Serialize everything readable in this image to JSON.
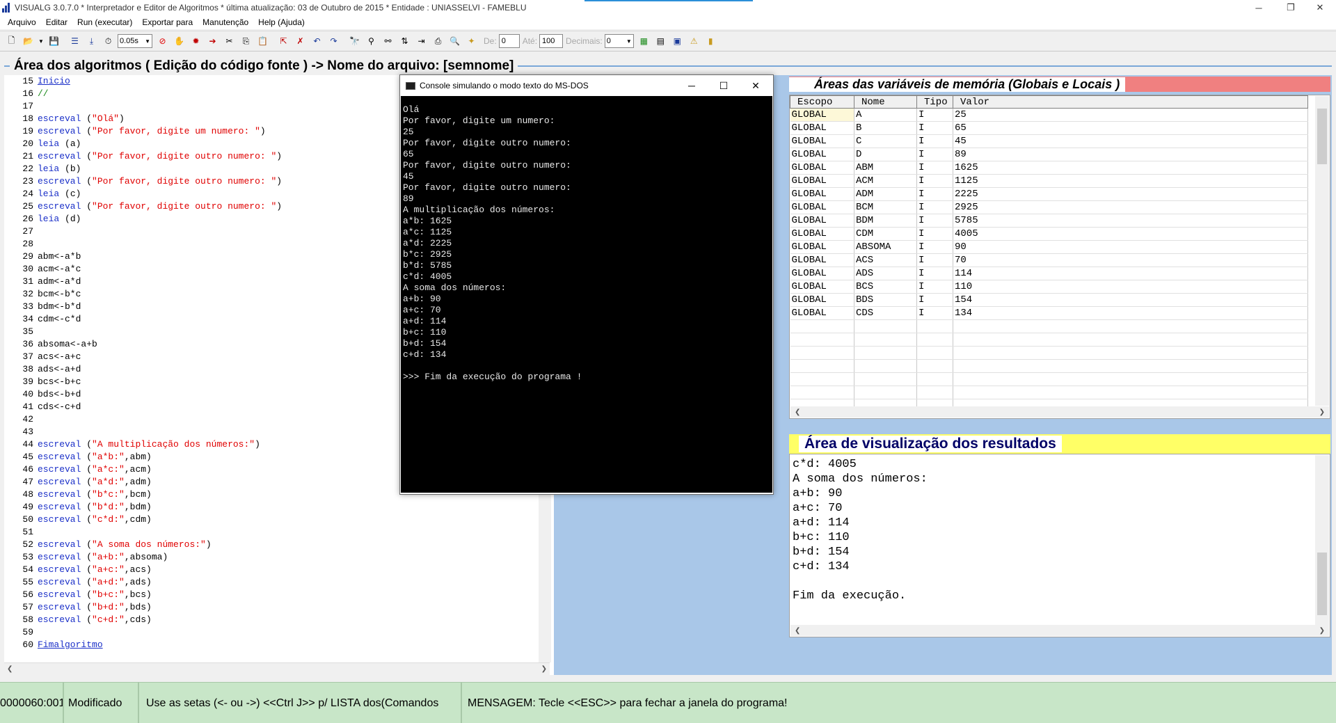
{
  "window": {
    "title": "VISUALG 3.0.7.0 * Interpretador e Editor de Algoritmos * última atualização: 03 de Outubro de 2015 * Entidade : UNIASSELVI - FAMEBLU",
    "controls": {
      "minimize": "─",
      "restore": "❐",
      "close": "✕"
    }
  },
  "menu": [
    "Arquivo",
    "Editar",
    "Run (executar)",
    "Exportar para",
    "Manutenção",
    "Help (Ajuda)"
  ],
  "toolbar": {
    "speed": "0.05s",
    "de_label": "De:",
    "de_value": "0",
    "ate_label": "Até:",
    "ate_value": "100",
    "decimais_label": "Decimais:",
    "decimais_value": "0"
  },
  "code_area": {
    "title": "Área dos algoritmos ( Edição do código fonte ) -> Nome do arquivo: [semnome]",
    "lines": [
      {
        "n": "15",
        "parts": [
          {
            "t": "Inicio",
            "c": "link"
          }
        ]
      },
      {
        "n": "16",
        "parts": [
          {
            "t": "//",
            "c": "com"
          }
        ]
      },
      {
        "n": "17",
        "parts": []
      },
      {
        "n": "18",
        "parts": [
          {
            "t": "escreval",
            "c": "kw"
          },
          {
            "t": " (",
            "c": ""
          },
          {
            "t": "\"Olá\"",
            "c": "str"
          },
          {
            "t": ")",
            "c": ""
          }
        ]
      },
      {
        "n": "19",
        "parts": [
          {
            "t": "escreval",
            "c": "kw"
          },
          {
            "t": " (",
            "c": ""
          },
          {
            "t": "\"Por favor, digite um numero: \"",
            "c": "str"
          },
          {
            "t": ")",
            "c": ""
          }
        ]
      },
      {
        "n": "20",
        "parts": [
          {
            "t": "leia",
            "c": "kw"
          },
          {
            "t": " (a)",
            "c": ""
          }
        ]
      },
      {
        "n": "21",
        "parts": [
          {
            "t": "escreval",
            "c": "kw"
          },
          {
            "t": " (",
            "c": ""
          },
          {
            "t": "\"Por favor, digite outro numero: \"",
            "c": "str"
          },
          {
            "t": ")",
            "c": ""
          }
        ]
      },
      {
        "n": "22",
        "parts": [
          {
            "t": "leia",
            "c": "kw"
          },
          {
            "t": " (b)",
            "c": ""
          }
        ]
      },
      {
        "n": "23",
        "parts": [
          {
            "t": "escreval",
            "c": "kw"
          },
          {
            "t": " (",
            "c": ""
          },
          {
            "t": "\"Por favor, digite outro numero: \"",
            "c": "str"
          },
          {
            "t": ")",
            "c": ""
          }
        ]
      },
      {
        "n": "24",
        "parts": [
          {
            "t": "leia",
            "c": "kw"
          },
          {
            "t": " (c)",
            "c": ""
          }
        ]
      },
      {
        "n": "25",
        "parts": [
          {
            "t": "escreval",
            "c": "kw"
          },
          {
            "t": " (",
            "c": ""
          },
          {
            "t": "\"Por favor, digite outro numero: \"",
            "c": "str"
          },
          {
            "t": ")",
            "c": ""
          }
        ]
      },
      {
        "n": "26",
        "parts": [
          {
            "t": "leia",
            "c": "kw"
          },
          {
            "t": " (d)",
            "c": ""
          }
        ]
      },
      {
        "n": "27",
        "parts": []
      },
      {
        "n": "28",
        "parts": []
      },
      {
        "n": "29",
        "parts": [
          {
            "t": "abm<-a*b",
            "c": ""
          }
        ]
      },
      {
        "n": "30",
        "parts": [
          {
            "t": "acm<-a*c",
            "c": ""
          }
        ]
      },
      {
        "n": "31",
        "parts": [
          {
            "t": "adm<-a*d",
            "c": ""
          }
        ]
      },
      {
        "n": "32",
        "parts": [
          {
            "t": "bcm<-b*c",
            "c": ""
          }
        ]
      },
      {
        "n": "33",
        "parts": [
          {
            "t": "bdm<-b*d",
            "c": ""
          }
        ]
      },
      {
        "n": "34",
        "parts": [
          {
            "t": "cdm<-c*d",
            "c": ""
          }
        ]
      },
      {
        "n": "35",
        "parts": []
      },
      {
        "n": "36",
        "parts": [
          {
            "t": "absoma<-a+b",
            "c": ""
          }
        ]
      },
      {
        "n": "37",
        "parts": [
          {
            "t": "acs<-a+c",
            "c": ""
          }
        ]
      },
      {
        "n": "38",
        "parts": [
          {
            "t": "ads<-a+d",
            "c": ""
          }
        ]
      },
      {
        "n": "39",
        "parts": [
          {
            "t": "bcs<-b+c",
            "c": ""
          }
        ]
      },
      {
        "n": "40",
        "parts": [
          {
            "t": "bds<-b+d",
            "c": ""
          }
        ]
      },
      {
        "n": "41",
        "parts": [
          {
            "t": "cds<-c+d",
            "c": ""
          }
        ]
      },
      {
        "n": "42",
        "parts": []
      },
      {
        "n": "43",
        "parts": []
      },
      {
        "n": "44",
        "parts": [
          {
            "t": "escreval",
            "c": "kw"
          },
          {
            "t": " (",
            "c": ""
          },
          {
            "t": "\"A multiplicação dos números:\"",
            "c": "str"
          },
          {
            "t": ")",
            "c": ""
          }
        ]
      },
      {
        "n": "45",
        "parts": [
          {
            "t": "escreval",
            "c": "kw"
          },
          {
            "t": " (",
            "c": ""
          },
          {
            "t": "\"a*b:\"",
            "c": "str"
          },
          {
            "t": ",abm)",
            "c": ""
          }
        ]
      },
      {
        "n": "46",
        "parts": [
          {
            "t": "escreval",
            "c": "kw"
          },
          {
            "t": " (",
            "c": ""
          },
          {
            "t": "\"a*c:\"",
            "c": "str"
          },
          {
            "t": ",acm)",
            "c": ""
          }
        ]
      },
      {
        "n": "47",
        "parts": [
          {
            "t": "escreval",
            "c": "kw"
          },
          {
            "t": " (",
            "c": ""
          },
          {
            "t": "\"a*d:\"",
            "c": "str"
          },
          {
            "t": ",adm)",
            "c": ""
          }
        ]
      },
      {
        "n": "48",
        "parts": [
          {
            "t": "escreval",
            "c": "kw"
          },
          {
            "t": " (",
            "c": ""
          },
          {
            "t": "\"b*c:\"",
            "c": "str"
          },
          {
            "t": ",bcm)",
            "c": ""
          }
        ]
      },
      {
        "n": "49",
        "parts": [
          {
            "t": "escreval",
            "c": "kw"
          },
          {
            "t": " (",
            "c": ""
          },
          {
            "t": "\"b*d:\"",
            "c": "str"
          },
          {
            "t": ",bdm)",
            "c": ""
          }
        ]
      },
      {
        "n": "50",
        "parts": [
          {
            "t": "escreval",
            "c": "kw"
          },
          {
            "t": " (",
            "c": ""
          },
          {
            "t": "\"c*d:\"",
            "c": "str"
          },
          {
            "t": ",cdm)",
            "c": ""
          }
        ]
      },
      {
        "n": "51",
        "parts": []
      },
      {
        "n": "52",
        "parts": [
          {
            "t": "escreval",
            "c": "kw"
          },
          {
            "t": " (",
            "c": ""
          },
          {
            "t": "\"A soma dos números:\"",
            "c": "str"
          },
          {
            "t": ")",
            "c": ""
          }
        ]
      },
      {
        "n": "53",
        "parts": [
          {
            "t": "escreval",
            "c": "kw"
          },
          {
            "t": " (",
            "c": ""
          },
          {
            "t": "\"a+b:\"",
            "c": "str"
          },
          {
            "t": ",absoma)",
            "c": ""
          }
        ]
      },
      {
        "n": "54",
        "parts": [
          {
            "t": "escreval",
            "c": "kw"
          },
          {
            "t": " (",
            "c": ""
          },
          {
            "t": "\"a+c:\"",
            "c": "str"
          },
          {
            "t": ",acs)",
            "c": ""
          }
        ]
      },
      {
        "n": "55",
        "parts": [
          {
            "t": "escreval",
            "c": "kw"
          },
          {
            "t": " (",
            "c": ""
          },
          {
            "t": "\"a+d:\"",
            "c": "str"
          },
          {
            "t": ",ads)",
            "c": ""
          }
        ]
      },
      {
        "n": "56",
        "parts": [
          {
            "t": "escreval",
            "c": "kw"
          },
          {
            "t": " (",
            "c": ""
          },
          {
            "t": "\"b+c:\"",
            "c": "str"
          },
          {
            "t": ",bcs)",
            "c": ""
          }
        ]
      },
      {
        "n": "57",
        "parts": [
          {
            "t": "escreval",
            "c": "kw"
          },
          {
            "t": " (",
            "c": ""
          },
          {
            "t": "\"b+d:\"",
            "c": "str"
          },
          {
            "t": ",bds)",
            "c": ""
          }
        ]
      },
      {
        "n": "58",
        "parts": [
          {
            "t": "escreval",
            "c": "kw"
          },
          {
            "t": " (",
            "c": ""
          },
          {
            "t": "\"c+d:\"",
            "c": "str"
          },
          {
            "t": ",cds)",
            "c": ""
          }
        ]
      },
      {
        "n": "59",
        "parts": []
      },
      {
        "n": "60",
        "parts": [
          {
            "t": "Fimalgoritmo",
            "c": "link"
          }
        ]
      }
    ]
  },
  "vars_panel": {
    "title": "Áreas das variáveis de memória (Globais e Locais )",
    "columns": [
      "Escopo",
      "Nome",
      "Tipo",
      "Valor"
    ],
    "rows": [
      [
        "GLOBAL",
        "A",
        "I",
        "25"
      ],
      [
        "GLOBAL",
        "B",
        "I",
        "65"
      ],
      [
        "GLOBAL",
        "C",
        "I",
        "45"
      ],
      [
        "GLOBAL",
        "D",
        "I",
        "89"
      ],
      [
        "GLOBAL",
        "ABM",
        "I",
        "1625"
      ],
      [
        "GLOBAL",
        "ACM",
        "I",
        "1125"
      ],
      [
        "GLOBAL",
        "ADM",
        "I",
        "2225"
      ],
      [
        "GLOBAL",
        "BCM",
        "I",
        "2925"
      ],
      [
        "GLOBAL",
        "BDM",
        "I",
        "5785"
      ],
      [
        "GLOBAL",
        "CDM",
        "I",
        "4005"
      ],
      [
        "GLOBAL",
        "ABSOMA",
        "I",
        "90"
      ],
      [
        "GLOBAL",
        "ACS",
        "I",
        "70"
      ],
      [
        "GLOBAL",
        "ADS",
        "I",
        "114"
      ],
      [
        "GLOBAL",
        "BCS",
        "I",
        "110"
      ],
      [
        "GLOBAL",
        "BDS",
        "I",
        "154"
      ],
      [
        "GLOBAL",
        "CDS",
        "I",
        "134"
      ]
    ]
  },
  "results_panel": {
    "title": "Área de visualização dos resultados",
    "lines": [
      "c*d: 4005",
      "A soma dos números:",
      "a+b: 90",
      "a+c: 70",
      "a+d: 114",
      "b+c: 110",
      "b+d: 154",
      "c+d: 134",
      "",
      "Fim da execução."
    ]
  },
  "console": {
    "title": "Console simulando o modo texto do MS-DOS",
    "lines": [
      "Olá",
      "Por favor, digite um numero:",
      "25",
      "Por favor, digite outro numero:",
      "65",
      "Por favor, digite outro numero:",
      "45",
      "Por favor, digite outro numero:",
      "89",
      "A multiplicação dos números:",
      "a*b: 1625",
      "a*c: 1125",
      "a*d: 2225",
      "b*c: 2925",
      "b*d: 5785",
      "c*d: 4005",
      "A soma dos números:",
      "a+b: 90",
      "a+c: 70",
      "a+d: 114",
      "b+c: 110",
      "b+d: 154",
      "c+d: 134",
      "",
      ">>> Fim da execução do programa !"
    ]
  },
  "statusbar": {
    "position": "0000060:001",
    "state": "Modificado",
    "hint": "Use as setas (<- ou ->) <<Ctrl J>> p/ LISTA dos(Comandos",
    "message": "MENSAGEM: Tecle <<ESC>> para fechar a janela do programa!"
  },
  "colors": {
    "right_bg": "#a9c7e8",
    "vars_header": "#f08080",
    "results_header": "#ffff66",
    "statusbar": "#c8e6c8",
    "keyword": "#1a2fc8",
    "string": "#e00000"
  }
}
